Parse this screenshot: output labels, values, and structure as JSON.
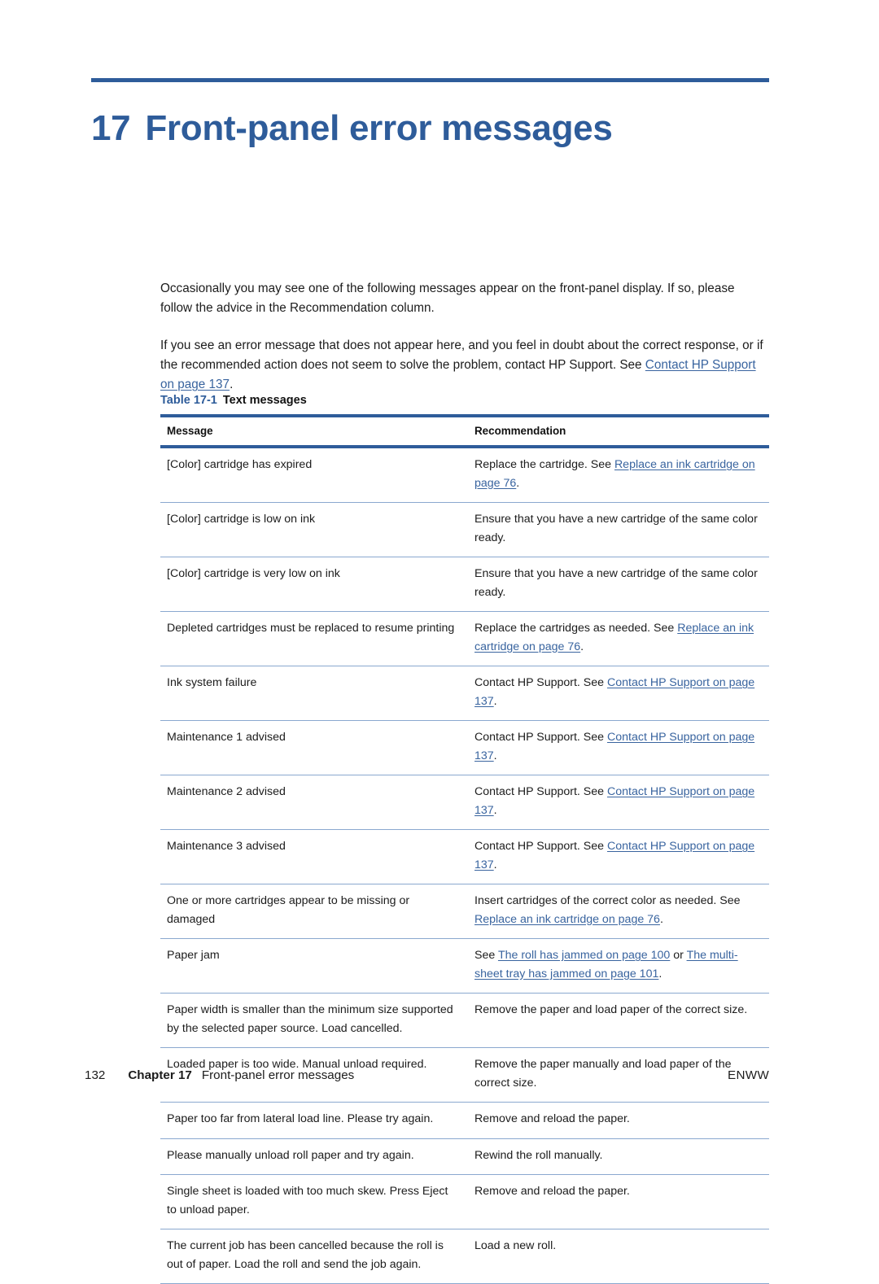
{
  "chapter": {
    "number": "17",
    "title": "Front-panel error messages"
  },
  "intro": {
    "paragraph1": "Occasionally you may see one of the following messages appear on the front-panel display. If so, please follow the advice in the Recommendation column.",
    "paragraph2_before": "If you see an error message that does not appear here, and you feel in doubt about the correct response, or if the recommended action does not seem to solve the problem, contact HP Support. See ",
    "paragraph2_link": "Contact HP Support on page 137",
    "paragraph2_after": "."
  },
  "table": {
    "caption_number": "Table 17-1",
    "caption_text": "Text messages",
    "headers": {
      "message": "Message",
      "recommendation": "Recommendation"
    },
    "rows": [
      {
        "message": "[Color] cartridge has expired",
        "recommendation_before": "Replace the cartridge. See ",
        "recommendation_link": "Replace an ink cartridge on page 76",
        "recommendation_after": "."
      },
      {
        "message": "[Color] cartridge is low on ink",
        "recommendation_before": "Ensure that you have a new cartridge of the same color ready.",
        "recommendation_link": "",
        "recommendation_after": ""
      },
      {
        "message": "[Color] cartridge is very low on ink",
        "recommendation_before": "Ensure that you have a new cartridge of the same color ready.",
        "recommendation_link": "",
        "recommendation_after": ""
      },
      {
        "message": "Depleted cartridges must be replaced to resume printing",
        "recommendation_before": "Replace the cartridges as needed. See ",
        "recommendation_link": "Replace an ink cartridge on page 76",
        "recommendation_after": "."
      },
      {
        "message": "Ink system failure",
        "recommendation_before": "Contact HP Support. See ",
        "recommendation_link": "Contact HP Support on page 137",
        "recommendation_after": "."
      },
      {
        "message": "Maintenance 1 advised",
        "recommendation_before": "Contact HP Support. See ",
        "recommendation_link": "Contact HP Support on page 137",
        "recommendation_after": "."
      },
      {
        "message": "Maintenance 2 advised",
        "recommendation_before": "Contact HP Support. See ",
        "recommendation_link": "Contact HP Support on page 137",
        "recommendation_after": "."
      },
      {
        "message": "Maintenance 3 advised",
        "recommendation_before": "Contact HP Support. See ",
        "recommendation_link": "Contact HP Support on page 137",
        "recommendation_after": "."
      },
      {
        "message": "One or more cartridges appear to be missing or damaged",
        "recommendation_before": "Insert cartridges of the correct color as needed. See ",
        "recommendation_link": "Replace an ink cartridge on page 76",
        "recommendation_after": "."
      },
      {
        "message": "Paper jam",
        "recommendation_before": "See ",
        "recommendation_link": "The roll has jammed on page 100",
        "recommendation_middle": " or ",
        "recommendation_link2": "The multi-sheet tray has jammed on page 101",
        "recommendation_after": "."
      },
      {
        "message": "Paper width is smaller than the minimum size supported by the selected paper source. Load cancelled.",
        "recommendation_before": "Remove the paper and load paper of the correct size.",
        "recommendation_link": "",
        "recommendation_after": ""
      },
      {
        "message": "Loaded paper is too wide. Manual unload required.",
        "recommendation_before": "Remove the paper manually and load paper of the correct size.",
        "recommendation_link": "",
        "recommendation_after": ""
      },
      {
        "message": "Paper too far from lateral load line. Please try again.",
        "recommendation_before": "Remove and reload the paper.",
        "recommendation_link": "",
        "recommendation_after": ""
      },
      {
        "message": "Please manually unload roll paper and try again.",
        "recommendation_before": "Rewind the roll manually.",
        "recommendation_link": "",
        "recommendation_after": ""
      },
      {
        "message": "Single sheet is loaded with too much skew. Press Eject to unload paper.",
        "recommendation_before": "Remove and reload the paper.",
        "recommendation_link": "",
        "recommendation_after": ""
      },
      {
        "message": "The current job has been cancelled because the roll is out of paper. Load the roll and send the job again.",
        "recommendation_before": "Load a new roll.",
        "recommendation_link": "",
        "recommendation_after": ""
      }
    ]
  },
  "footer": {
    "page_number": "132",
    "chapter_label": "Chapter 17",
    "chapter_title": "Front-panel error messages",
    "right_label": "ENWW"
  },
  "colors": {
    "accent_blue": "#2e5c9a",
    "link_blue": "#39649f",
    "rule_light": "#8aa8cf"
  }
}
